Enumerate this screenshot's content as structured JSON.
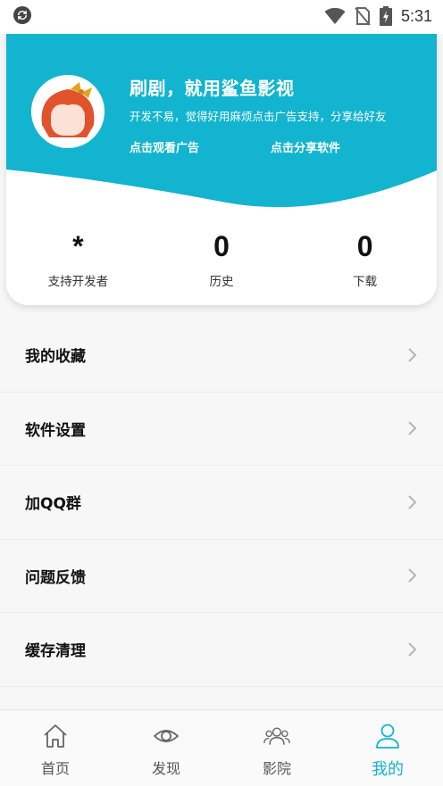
{
  "status_bar": {
    "time": "5:31",
    "icons": [
      "sync-icon",
      "wifi-icon",
      "no-sim-icon",
      "battery-charging-icon"
    ]
  },
  "profile": {
    "avatar_icon": "cartoon-girl-avatar-icon",
    "promo_title": "刷剧，就用鲨鱼影视",
    "promo_subtitle": "开发不易，觉得好用麻烦点击广告支持，分享给好友",
    "watch_ad_label": "点击观看广告",
    "share_label": "点击分享软件",
    "accent_color": "#12b4cf"
  },
  "stats": [
    {
      "value": "*",
      "label": "支持开发者"
    },
    {
      "value": "0",
      "label": "历史"
    },
    {
      "value": "0",
      "label": "下载"
    }
  ],
  "menu": {
    "items": [
      {
        "label": "我的收藏"
      },
      {
        "label": "软件设置"
      },
      {
        "label": "加QQ群"
      },
      {
        "label": "问题反馈"
      },
      {
        "label": "缓存清理"
      }
    ]
  },
  "bottom_nav": {
    "items": [
      {
        "label": "首页",
        "icon": "home-icon"
      },
      {
        "label": "发现",
        "icon": "eye-icon"
      },
      {
        "label": "影院",
        "icon": "group-icon"
      },
      {
        "label": "我的",
        "icon": "person-icon",
        "active": true
      }
    ]
  }
}
